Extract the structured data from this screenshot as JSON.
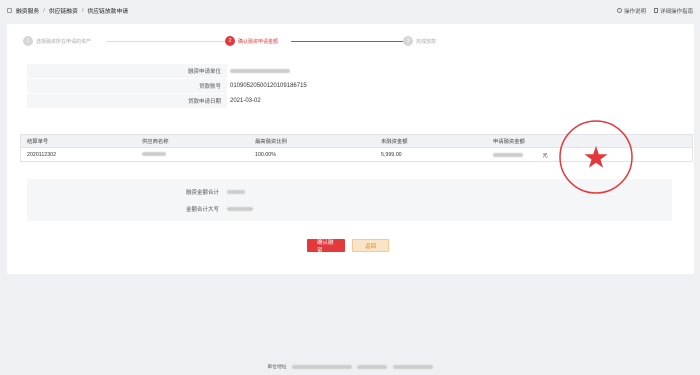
{
  "breadcrumb": {
    "items": [
      "融资服务",
      "供应链融资",
      "供应链放款申请"
    ]
  },
  "top_links": {
    "help": "操作说明",
    "detail": "详细操作指南"
  },
  "steps": [
    {
      "num": "1",
      "label": "选择融资所在申请的资产",
      "active": false
    },
    {
      "num": "2",
      "label": "确认融资申请金额",
      "active": true
    },
    {
      "num": "3",
      "label": "完成放款",
      "active": false
    }
  ],
  "info": {
    "org_label": "融资申请单位",
    "loan_no_label": "贷款账号",
    "loan_no_value": "01090520500120109186715",
    "date_label": "贷款申请日期",
    "date_value": "2021-03-02"
  },
  "table": {
    "headers": [
      "结算单号",
      "供应商名称",
      "最高融资比例",
      "未融资金额",
      "申请融资金额",
      ""
    ],
    "rows": [
      {
        "order_no": "2020112302",
        "ratio": "100.00%",
        "unfunded": "5,999.00",
        "unit": "元"
      }
    ]
  },
  "summary": {
    "total_label": "融资金额合计",
    "upper_label": "金额合计大写"
  },
  "buttons": {
    "confirm": "确认融资",
    "back": "返回"
  },
  "footer": {
    "label": "单位地址"
  },
  "colors": {
    "accent": "#e4393c",
    "back_bg": "#fbe3c6"
  }
}
